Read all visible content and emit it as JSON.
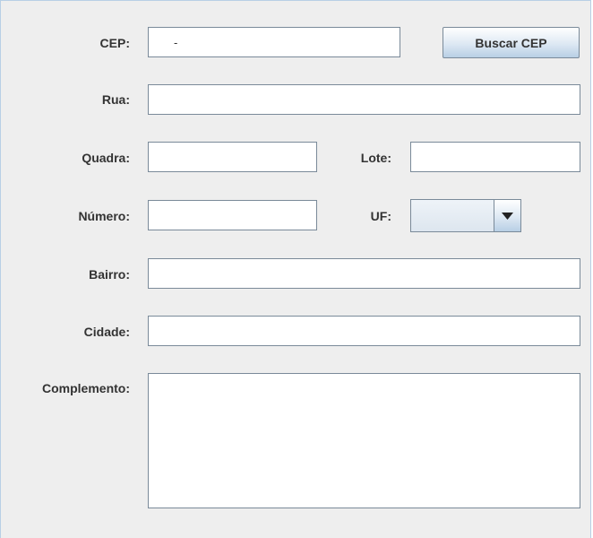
{
  "form": {
    "labels": {
      "cep": "CEP:",
      "rua": "Rua:",
      "quadra": "Quadra:",
      "lote": "Lote:",
      "numero": "Número:",
      "uf": "UF:",
      "bairro": "Bairro:",
      "cidade": "Cidade:",
      "complemento": "Complemento:"
    },
    "values": {
      "cep": "-",
      "rua": "",
      "quadra": "",
      "lote": "",
      "numero": "",
      "uf": "",
      "bairro": "",
      "cidade": "",
      "complemento": ""
    },
    "buttons": {
      "buscar_cep": "Buscar CEP"
    },
    "icons": {
      "uf_dropdown": "chevron-down-icon"
    }
  },
  "colors": {
    "panel_background": "#eeeeee",
    "field_border": "#7a8a99",
    "button_gradient_end": "#b8cfe5",
    "label_text": "#333333"
  }
}
